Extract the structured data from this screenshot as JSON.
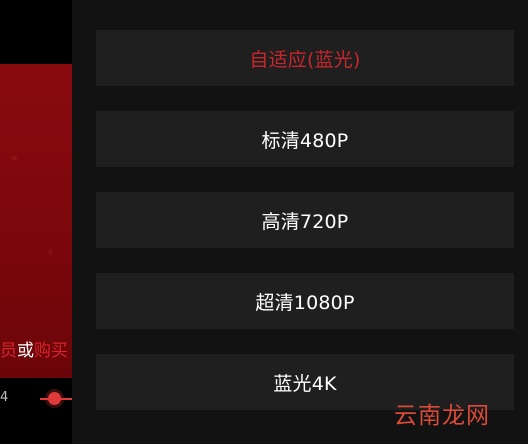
{
  "video": {
    "promo": {
      "part1": "员",
      "part2": "或",
      "part3": "购买"
    },
    "time_label": "4"
  },
  "quality_menu": {
    "options": [
      {
        "label": "自适应(蓝光)",
        "selected": true
      },
      {
        "label": "标清480P",
        "selected": false
      },
      {
        "label": "高清720P",
        "selected": false
      },
      {
        "label": "超清1080P",
        "selected": false
      },
      {
        "label": "蓝光4K",
        "selected": false
      }
    ]
  },
  "watermark": "云南龙网",
  "colors": {
    "accent_red": "#c9262c",
    "panel_bg": "#121212",
    "option_bg": "#1f1f1f",
    "video_red": "#8a0a0f"
  }
}
